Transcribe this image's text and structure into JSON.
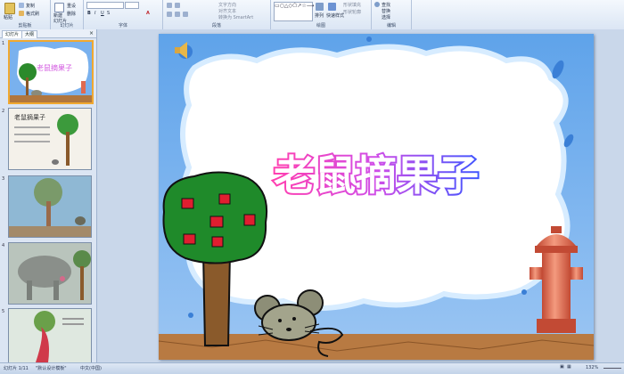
{
  "ribbon": {
    "groups": [
      {
        "label": "剪贴板",
        "items": [
          "粘贴",
          "复制",
          "格式刷"
        ]
      },
      {
        "label": "幻灯片",
        "items": [
          "新建",
          "幻灯片",
          "重设",
          "删除"
        ]
      },
      {
        "label": "字体",
        "items": [
          "B",
          "I",
          "U",
          "S",
          "A"
        ]
      },
      {
        "label": "段落",
        "items": [
          "文字方向",
          "对齐文本",
          "转换为 SmartArt"
        ]
      },
      {
        "label": "绘图",
        "items": [
          "排列",
          "快速样式",
          "形状填充",
          "形状轮廓"
        ]
      },
      {
        "label": "编辑",
        "items": [
          "查找",
          "替换",
          "选择"
        ]
      }
    ]
  },
  "panel": {
    "tabs": [
      "幻灯片",
      "大纲"
    ],
    "slide_numbers": [
      "1",
      "2",
      "3",
      "4",
      "5"
    ]
  },
  "slide": {
    "title": "老鼠摘果子",
    "thumb2_title": "老鼠摘果子"
  },
  "status": {
    "slide_info": "幻灯片 1/11",
    "theme": "\"默认设计模板\"",
    "language": "中文(中国)",
    "zoom": "132%"
  },
  "colors": {
    "accent": "#4a78c2",
    "title_gradient_start": "#ff3fb0",
    "title_gradient_end": "#3f55ff"
  }
}
